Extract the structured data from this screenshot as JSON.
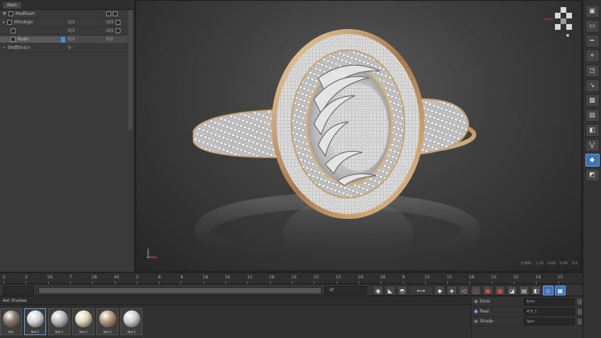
{
  "left_panel": {
    "header_tab": "Item",
    "rows": [
      {
        "name": "Medfeam",
        "a": "",
        "b": "",
        "expanded": true
      },
      {
        "name": "Mhrdvgo",
        "a": "E|5",
        "b": "G|5",
        "expanded": true
      },
      {
        "name": "",
        "a": "E|5",
        "b": "G|5",
        "expanded": false
      },
      {
        "name": "Rudn",
        "a": "E|5",
        "b": "E|2",
        "selected": true
      },
      {
        "name": "Shdfblnicn",
        "a": "9",
        "b": ""
      }
    ]
  },
  "timeline": {
    "ticks": [
      "2",
      "2",
      "56",
      "7",
      "28",
      "40",
      "5",
      "8",
      "8",
      "18",
      "16",
      "15",
      "28",
      "15",
      "15",
      "15",
      "16",
      "18",
      "8",
      "15",
      "15",
      "18",
      "15",
      "15",
      "18",
      "15"
    ]
  },
  "transport": {
    "range_end": "6f",
    "buttons": [
      "record-icon",
      "key-icon",
      "motion-icon",
      "slider",
      "keyframe-icon",
      "sound-icon",
      "prev-icon",
      "stop-red-icon",
      "record-red-icon",
      "grid-red-icon",
      "render-icon",
      "render-region-icon",
      "render-settings-icon",
      "snap-icon",
      "sync-icon"
    ]
  },
  "viewport": {
    "status_items": [
      "0.800",
      "1.29",
      "0.00",
      "0.00",
      "0.0"
    ]
  },
  "materials": {
    "header": "Ael Shadea",
    "swatches": [
      {
        "label": "Mat",
        "color": "#8a7a6a"
      },
      {
        "label": "Mat.1",
        "color": "#d8d8d8"
      },
      {
        "label": "Mat.2",
        "color": "#bcbcbc"
      },
      {
        "label": "Mat.3",
        "color": "#e6d5b8"
      },
      {
        "label": "Mat.4",
        "color": "#b59a7a"
      },
      {
        "label": "Mat.5",
        "color": "#cfcfcf"
      }
    ]
  },
  "attributes": {
    "rows": [
      {
        "label": "Emis",
        "value": "Emit",
        "dot": "gray"
      },
      {
        "label": "Real",
        "value": "4*5_1",
        "dot": "blue"
      },
      {
        "label": "Shade",
        "value": "Spin",
        "dot": "gray"
      }
    ]
  }
}
